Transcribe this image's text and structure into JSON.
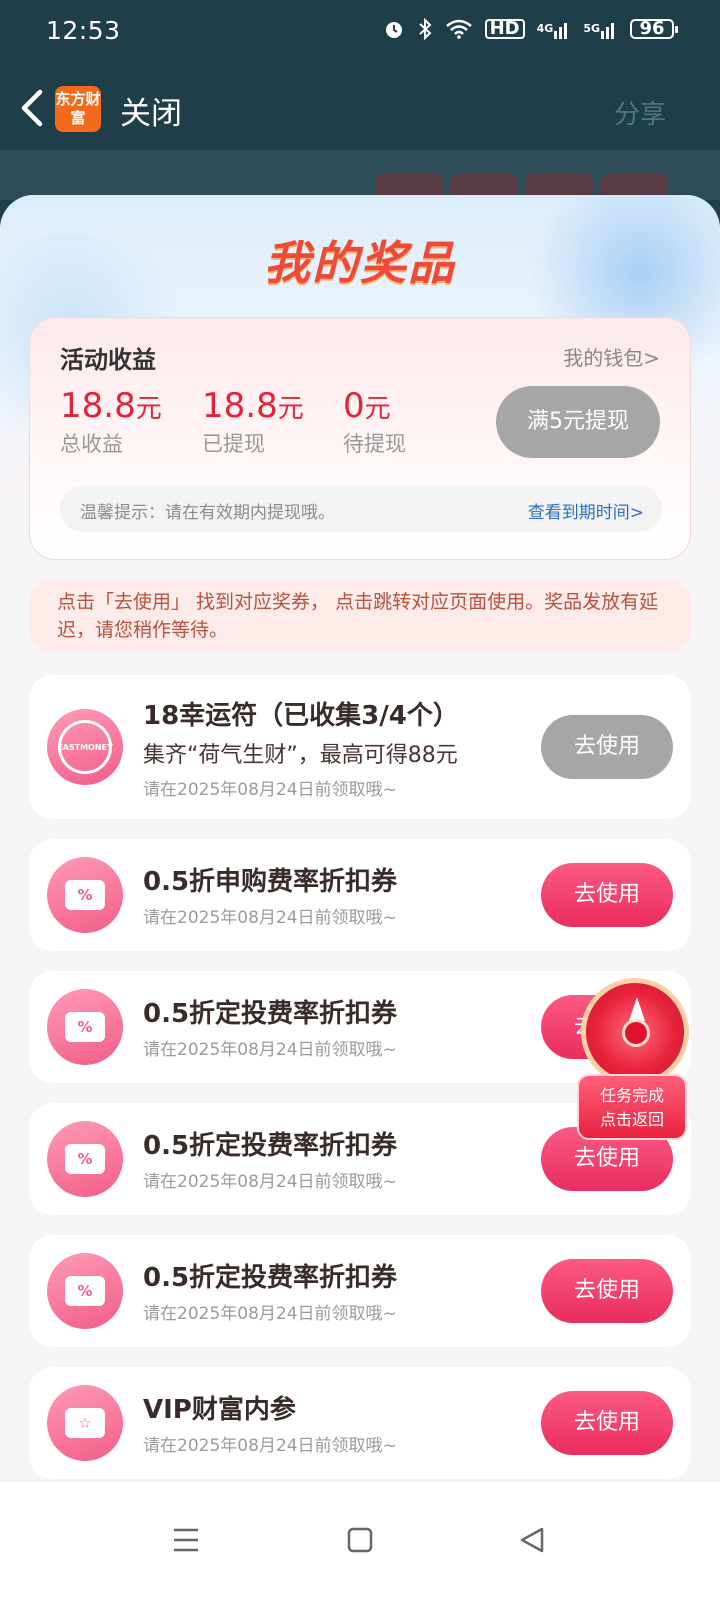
{
  "status_bar": {
    "time": "12:53",
    "hd": "HD",
    "net_4g": "4G",
    "net_5g": "5G",
    "battery": "96"
  },
  "navbar": {
    "brand_logo_text": "东方财富",
    "close_label": "关闭",
    "share_label": "分享"
  },
  "sheet": {
    "title": "我的奖品"
  },
  "earnings": {
    "title": "活动收益",
    "wallet_link": "我的钱包>",
    "total_value": "18.8",
    "total_unit": "元",
    "total_label": "总收益",
    "withdrawn_value": "18.8",
    "withdrawn_unit": "元",
    "withdrawn_label": "已提现",
    "pending_value": "0",
    "pending_unit": "元",
    "pending_label": "待提现",
    "withdraw_button": "满5元提现",
    "tip_text": "温馨提示：请在有效期内提现哦。",
    "tip_link": "查看到期时间>"
  },
  "notice": {
    "text": "点击「去使用」 找到对应奖券， 点击跳转对应页面使用。奖品发放有延迟，请您稍作等待。"
  },
  "prizes": [
    {
      "name": "18幸运符（已收集3/4个）",
      "desc": "集齐“荷气生财”，最高可得88元",
      "expire": "请在2025年08月24日前领取哦~",
      "button": "去使用",
      "icon": "lucky-charm-icon",
      "icon_text": "EASTMONEY"
    },
    {
      "name": "0.5折申购费率折扣券",
      "expire": "请在2025年08月24日前领取哦~",
      "button": "去使用",
      "icon": "percent-ticket-icon",
      "icon_text": "%"
    },
    {
      "name": "0.5折定投费率折扣券",
      "expire": "请在2025年08月24日前领取哦~",
      "button": "去使用",
      "icon": "percent-ticket-icon",
      "icon_text": "%"
    },
    {
      "name": "0.5折定投费率折扣券",
      "expire": "请在2025年08月24日前领取哦~",
      "button": "去使用",
      "icon": "percent-ticket-icon",
      "icon_text": "%"
    },
    {
      "name": "0.5折定投费率折扣券",
      "expire": "请在2025年08月24日前领取哦~",
      "button": "去使用",
      "icon": "percent-ticket-icon",
      "icon_text": "%"
    },
    {
      "name": "VIP财富内参",
      "expire": "请在2025年08月24日前领取哦~",
      "button": "去使用",
      "icon": "star-ticket-icon",
      "icon_text": "☆"
    }
  ],
  "float_widget": {
    "line1": "任务完成",
    "line2": "点击返回"
  },
  "colors": {
    "accent_red": "#e3233a",
    "button_pink": "#ea2d5f",
    "disabled_gray": "#a6a6a6",
    "link_blue": "#2d6fbf"
  }
}
